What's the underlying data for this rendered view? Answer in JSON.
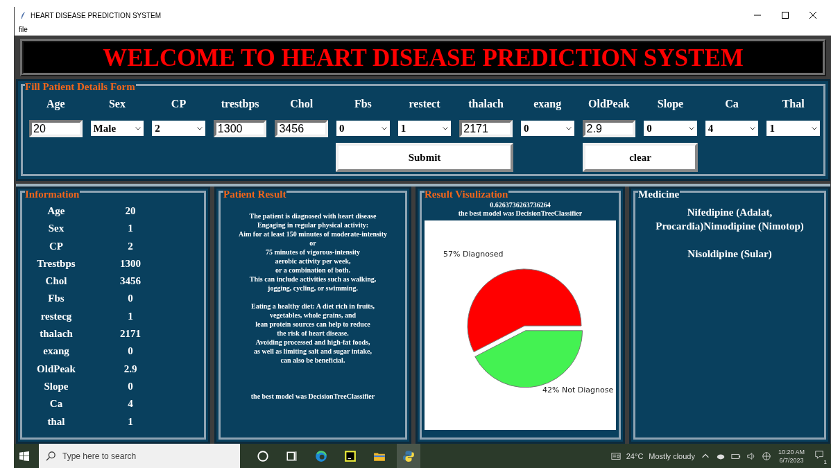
{
  "window": {
    "title": "HEART DISEASE PREDICTION SYSTEM"
  },
  "menu": [
    "file"
  ],
  "banner": "WELCOME TO HEART DISEASE PREDICTION SYSTEM",
  "form": {
    "title": "Fill Patient Details Form",
    "fields": [
      {
        "label": "Age",
        "kind": "entry",
        "value": "20"
      },
      {
        "label": "Sex",
        "kind": "select",
        "value": "Male"
      },
      {
        "label": "CP",
        "kind": "select",
        "value": "2"
      },
      {
        "label": "trestbps",
        "kind": "entry",
        "value": "1300"
      },
      {
        "label": "Chol",
        "kind": "entry",
        "value": "3456"
      },
      {
        "label": "Fbs",
        "kind": "select",
        "value": "0"
      },
      {
        "label": "restect",
        "kind": "select",
        "value": "1"
      },
      {
        "label": "thalach",
        "kind": "entry",
        "value": "2171"
      },
      {
        "label": "exang",
        "kind": "select",
        "value": "0"
      },
      {
        "label": "OldPeak",
        "kind": "entry",
        "value": "2.9"
      },
      {
        "label": "Slope",
        "kind": "select",
        "value": "0"
      },
      {
        "label": "Ca",
        "kind": "select",
        "value": "4"
      },
      {
        "label": "Thal",
        "kind": "select",
        "value": "1"
      }
    ],
    "buttons": [
      "Submit",
      "clear"
    ]
  },
  "information": {
    "title": "Information",
    "rows": [
      {
        "name": "Age",
        "value": "20"
      },
      {
        "name": "Sex",
        "value": "1"
      },
      {
        "name": "CP",
        "value": "2"
      },
      {
        "name": "Trestbps",
        "value": "1300"
      },
      {
        "name": "Chol",
        "value": "3456"
      },
      {
        "name": "Fbs",
        "value": "0"
      },
      {
        "name": "restecg",
        "value": "1"
      },
      {
        "name": "thalach",
        "value": "2171"
      },
      {
        "name": "exang",
        "value": "0"
      },
      {
        "name": "OldPeak",
        "value": "2.9"
      },
      {
        "name": "Slope",
        "value": "0"
      },
      {
        "name": "Ca",
        "value": "4"
      },
      {
        "name": "thal",
        "value": "1"
      }
    ]
  },
  "patient_result": {
    "title": "Patient Result",
    "paragraphs": [
      [
        "The patient is diagnosed with heart disease",
        "Engaging in regular physical activity:",
        "Aim for at least 150 minutes of moderate-intensity",
        "or",
        "75 minutes of vigorous-intensity",
        "aerobic activity per week,",
        "or a combination of both.",
        "This can include activities such as walking,",
        "jogging, cycling, or swimming."
      ],
      [
        "Eating a healthy diet: A diet rich in fruits,",
        "vegetables, whole grains, and",
        "lean protein sources can help to reduce",
        "the risk of heart disease.",
        "Avoiding processed and high-fat foods,",
        "as well as limiting salt and sugar intake,",
        "can also be beneficial."
      ]
    ],
    "best_model": "the best model was  DecisionTreeClassifier"
  },
  "visualization": {
    "title": "Result Visulization",
    "accuracy": "0.6263736263736264",
    "best_model": "the best model was  DecisionTreeClassifier",
    "chart_data": {
      "type": "pie",
      "categories": [
        "57% Diagnosed",
        "42% Not Diagnose"
      ],
      "values": [
        57,
        42
      ],
      "colors": [
        "#ff0000",
        "#44f252"
      ]
    }
  },
  "medicine": {
    "title": "Medicine",
    "lines": [
      "Nifedipine (Adalat, Procardia)Nimodipine (Nimotop)",
      "Nisoldipine (Sular)"
    ]
  },
  "taskbar": {
    "search_placeholder": "Type here to search",
    "weather": "24°C",
    "weather_text": "Mostly cloudy",
    "time": "10:20 AM",
    "date": "6/7/2023",
    "notification_count": "1"
  }
}
